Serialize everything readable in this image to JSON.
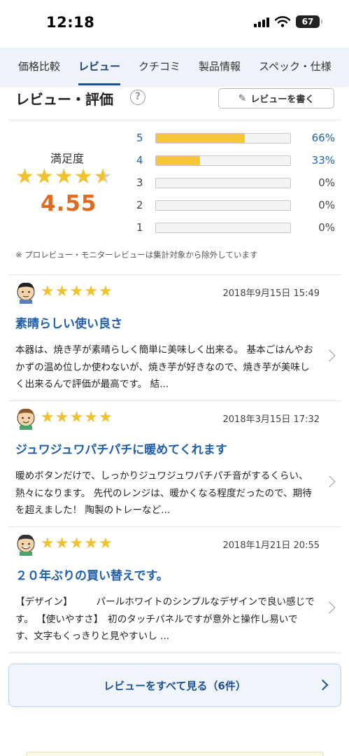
{
  "status": {
    "time": "12:18",
    "battery": "67"
  },
  "tabs": [
    {
      "label": "価格比較"
    },
    {
      "label": "レビュー"
    },
    {
      "label": "クチコミ"
    },
    {
      "label": "製品情報"
    },
    {
      "label": "スペック・仕様"
    }
  ],
  "header": {
    "title": "レビュー・評価",
    "help": "?",
    "write_button": "レビューを書く"
  },
  "summary": {
    "satisfaction_label": "満足度",
    "average": "4.55",
    "average_value": 4.55,
    "distribution": [
      {
        "stars": "5",
        "percent": "66%",
        "fraction": 0.66
      },
      {
        "stars": "4",
        "percent": "33%",
        "fraction": 0.33
      },
      {
        "stars": "3",
        "percent": "0%",
        "fraction": 0
      },
      {
        "stars": "2",
        "percent": "0%",
        "fraction": 0
      },
      {
        "stars": "1",
        "percent": "0%",
        "fraction": 0
      }
    ],
    "note": "※ プロレビュー・モニターレビューは集計対象から除外しています"
  },
  "reviews": [
    {
      "rating": 5,
      "date": "2018年9月15日 15:49",
      "title": "素晴らしい使い良さ",
      "body": "本器は、焼き芋が素晴らしく簡単に美味しく出来る。 基本ごはんやおかずの温め位しか使わないが、焼き芋が好きなので、焼き芋が美味しく出来るんで評価が最高です。 結..."
    },
    {
      "rating": 5,
      "date": "2018年3月15日 17:32",
      "title": "ジュワジュワパチパチに暖めてくれます",
      "body": "暖めボタンだけで、しっかりジュワジュワパチパチ音がするくらい、熱々になります。 先代のレンジは、暖かくなる程度だったので、期待を超えました！ 陶製のトレーなど..."
    },
    {
      "rating": 5,
      "date": "2018年1月21日 20:55",
      "title": "２０年ぶりの買い替えです。",
      "body": "【デザイン】　　　パールホワイトのシンプルなデザインで良い感じです。 【使いやすさ】　初のタッチパネルですが意外と操作し易いです、文字もくっきりと見やすいし ..."
    }
  ],
  "all_reviews_button": "レビューをすべて見る（6件）",
  "colors": {
    "accent": "#1a4f96",
    "link": "#1f64b0",
    "star": "#f2c12e",
    "score": "#e06b1f",
    "bar_fill": "#f5c739"
  }
}
